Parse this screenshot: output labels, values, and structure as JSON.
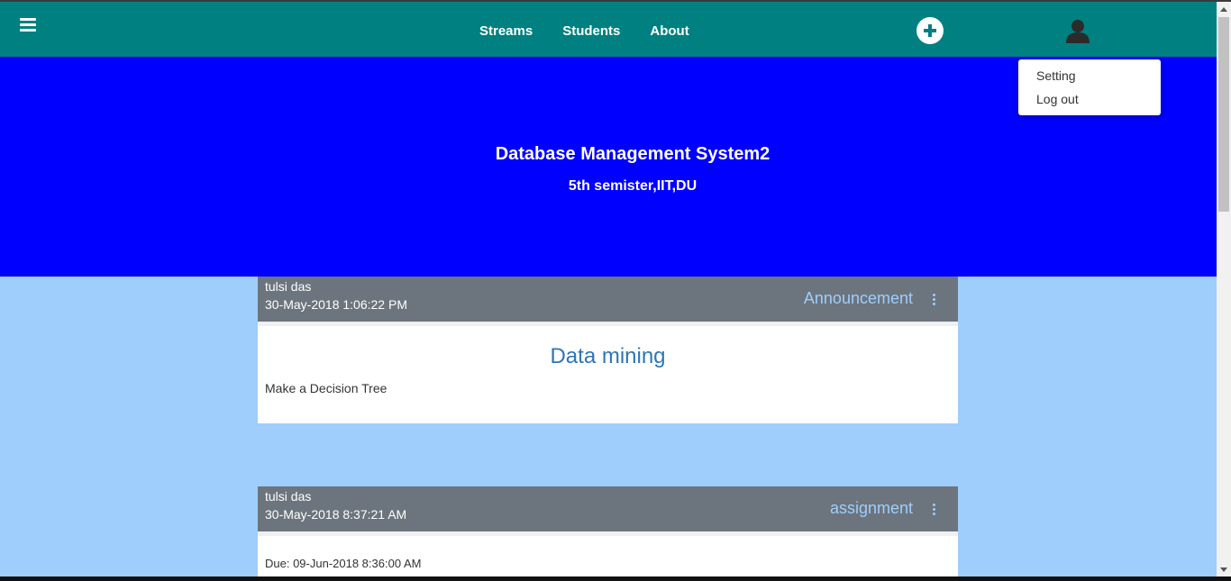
{
  "colors": {
    "navbar": "#008080",
    "hero": "#0000ff",
    "page_background": "#9fcdfc",
    "card_header": "#6c757d",
    "post_title": "#2f75b5"
  },
  "navbar": {
    "menu_icon": "hamburger-icon",
    "links": [
      "Streams",
      "Students",
      "About"
    ],
    "add_icon": "plus-circle-icon",
    "user_icon": "user-icon"
  },
  "user_menu": {
    "items": [
      "Setting",
      "Log out"
    ]
  },
  "hero": {
    "title": "Database Management System2",
    "subtitle": "5th semister,IIT,DU"
  },
  "posts": [
    {
      "author": "tulsi das",
      "date": "30-May-2018 1:06:22 PM",
      "type": "Announcement",
      "title": "Data mining",
      "description": "Make a Decision Tree"
    },
    {
      "author": "tulsi das",
      "date": "30-May-2018 8:37:21 AM",
      "type": "assignment",
      "due": "Due: 09-Jun-2018 8:36:00 AM"
    }
  ]
}
